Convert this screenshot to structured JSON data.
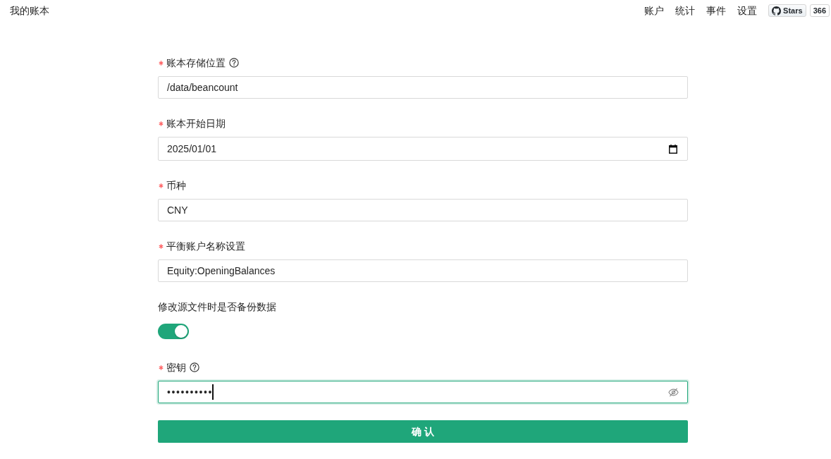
{
  "header": {
    "title": "我的账本",
    "nav": [
      {
        "label": "账户"
      },
      {
        "label": "统计"
      },
      {
        "label": "事件"
      },
      {
        "label": "设置"
      }
    ],
    "github": {
      "label": "Stars",
      "count": "366"
    }
  },
  "form": {
    "fields": [
      {
        "kind": "text",
        "label": "账本存储位置",
        "required": true,
        "help": true,
        "value": "/data/beancount",
        "focused": false
      },
      {
        "kind": "date",
        "label": "账本开始日期",
        "required": true,
        "help": false,
        "value": "2025/01/01",
        "focused": false
      },
      {
        "kind": "text",
        "label": "币种",
        "required": true,
        "help": false,
        "value": "CNY",
        "focused": false
      },
      {
        "kind": "text",
        "label": "平衡账户名称设置",
        "required": true,
        "help": false,
        "value": "Equity:OpeningBalances",
        "focused": false
      },
      {
        "kind": "switch",
        "label": "修改源文件时是否备份数据",
        "required": false,
        "help": false,
        "on": true
      },
      {
        "kind": "password",
        "label": "密钥",
        "required": true,
        "help": true,
        "value": "••••••••••",
        "focused": true
      }
    ],
    "submit": "确 认"
  }
}
